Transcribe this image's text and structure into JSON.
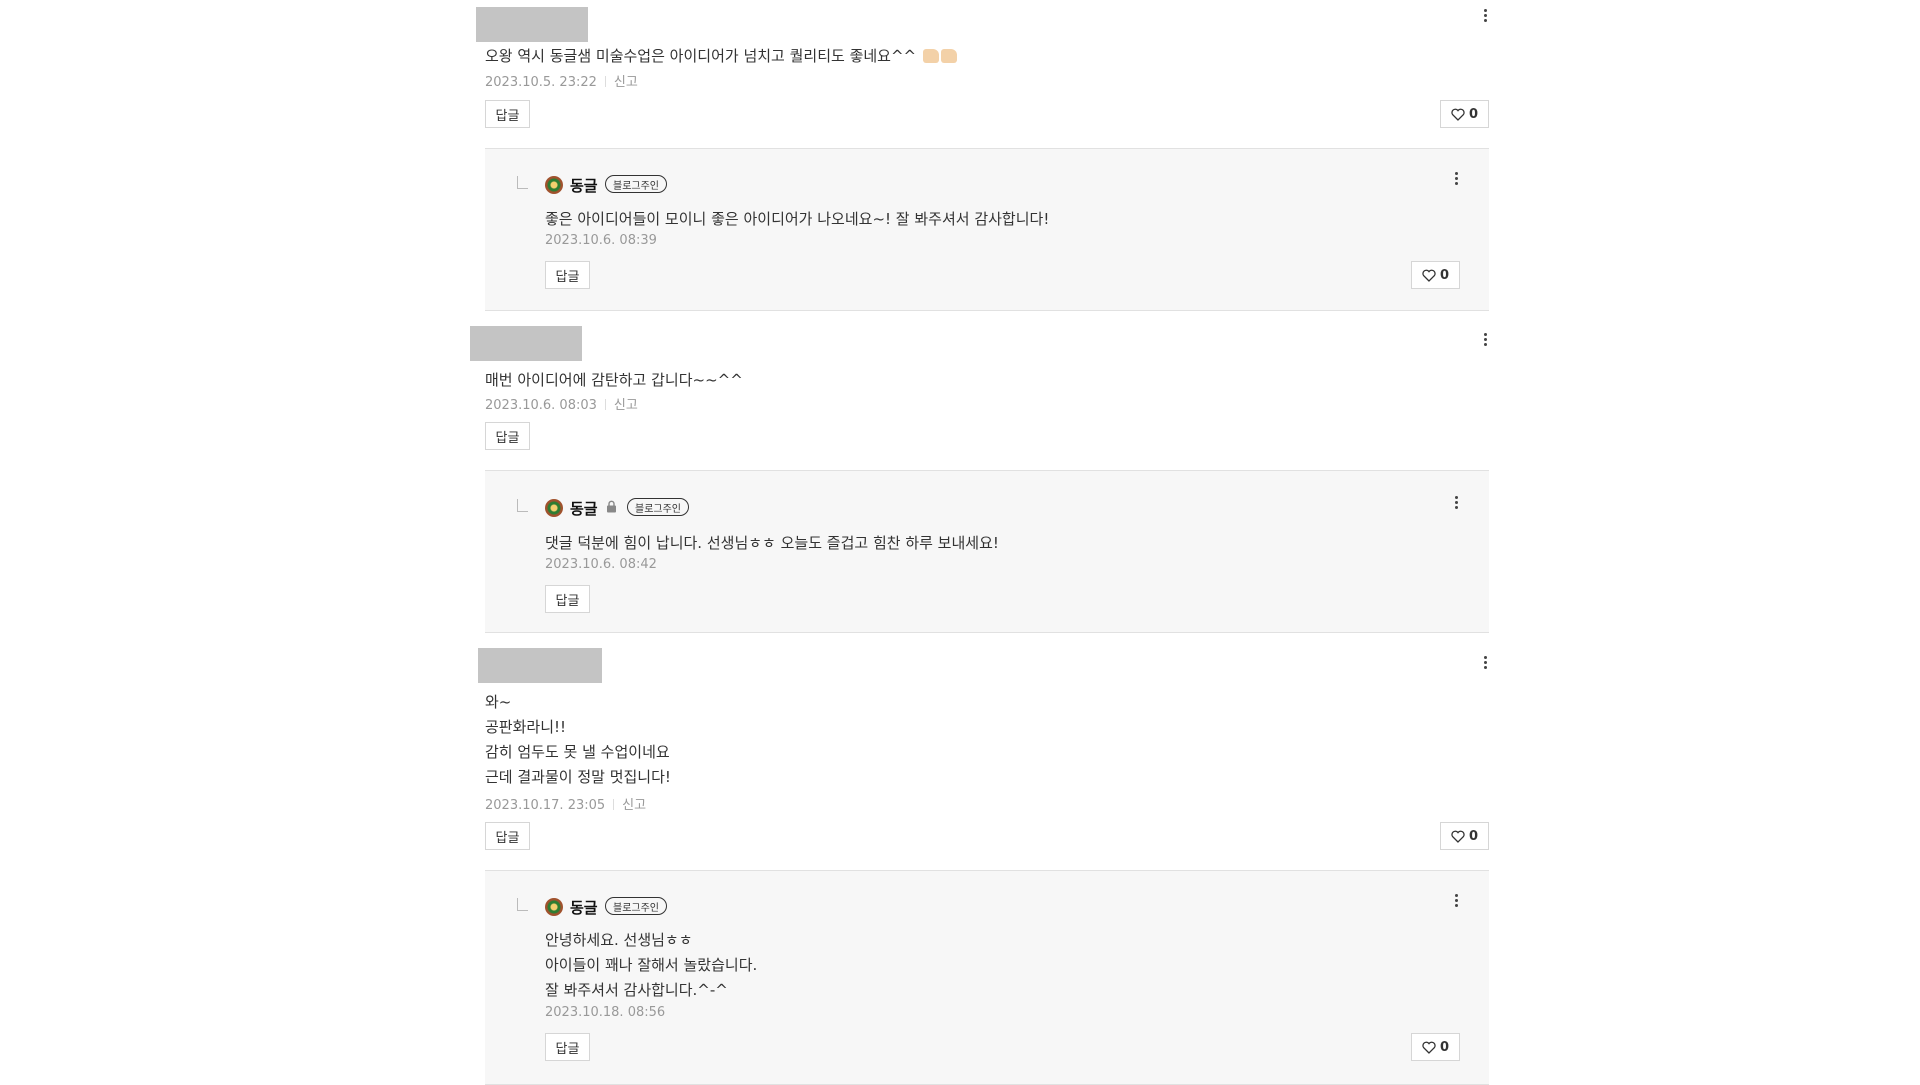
{
  "labels": {
    "reply_button": "답글",
    "report": "신고",
    "owner_badge": "블로그주인"
  },
  "comments": [
    {
      "text": "오왕 역시 동글샘 미술수업은 아이디어가 넘치고 퀄리티도 좋네요^^",
      "emoji": "👍🏻👍🏻",
      "date": "2023.10.5. 23:22",
      "likes": "0",
      "reply": {
        "author": "동글",
        "lines": [
          "좋은 아이디어들이 모이니 좋은 아이디어가 나오네요~! 잘 봐주셔서 감사합니다!"
        ],
        "date": "2023.10.6. 08:39",
        "likes": "0"
      }
    },
    {
      "text": "매번 아이디어에 감탄하고 갑니다~~^^",
      "date": "2023.10.6. 08:03",
      "reply": {
        "author": "동글",
        "locked": true,
        "lines": [
          "댓글 덕분에 힘이 납니다. 선생님ㅎㅎ 오늘도 즐겁고 힘찬 하루 보내세요!"
        ],
        "date": "2023.10.6. 08:42"
      }
    },
    {
      "lines": [
        "와~",
        "공판화라니!!",
        "감히 엄두도 못 낼 수업이네요",
        "근데 결과물이 정말 멋집니다!"
      ],
      "date": "2023.10.17. 23:05",
      "likes": "0",
      "reply": {
        "author": "동글",
        "lines": [
          "안녕하세요. 선생님ㅎㅎ",
          "아이들이 꽤나 잘해서 놀랐습니다.",
          "잘 봐주셔서 감사합니다.^-^"
        ],
        "date": "2023.10.18. 08:56",
        "likes": "0"
      }
    }
  ],
  "icons": {
    "more": "more-vertical-icon",
    "like": "heart-outline-icon",
    "lock": "lock-icon",
    "avatar": "flower-avatar"
  }
}
